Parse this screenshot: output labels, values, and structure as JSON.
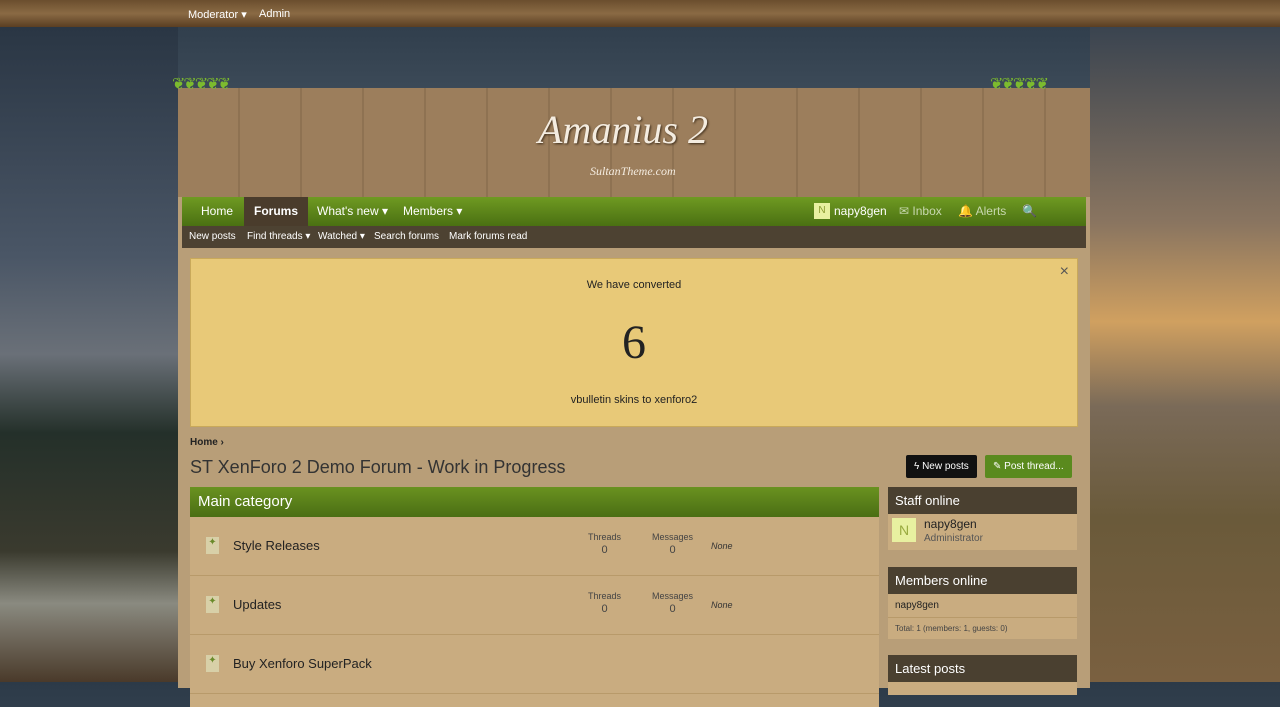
{
  "topbar": {
    "moderator": "Moderator ▾",
    "admin": "Admin"
  },
  "header": {
    "logo": "Amanius 2",
    "logo_sub": "SultanTheme.com"
  },
  "nav": {
    "home": "Home",
    "forums": "Forums",
    "whats_new": "What's new ▾",
    "members": "Members ▾",
    "avatar_letter": "N",
    "user": "napy8gen",
    "inbox": "✉ Inbox",
    "alerts": "🔔 Alerts",
    "search": "🔍 Search"
  },
  "subnav": [
    "New posts",
    "Find threads ▾",
    "Watched ▾",
    "Search forums",
    "Mark forums read"
  ],
  "notice": {
    "line1": "We have converted",
    "number": "6",
    "line2": "vbulletin skins to xenforo2",
    "close": "×"
  },
  "breadcrumb": "Home ›",
  "page_title": "ST XenForo 2 Demo Forum - Work in Progress",
  "buttons": {
    "new_posts": "ϟ New posts",
    "post_thread": "✎ Post thread..."
  },
  "category": "Main category",
  "forums": [
    {
      "name": "Style Releases",
      "threads_label": "Threads",
      "threads": "0",
      "messages_label": "Messages",
      "messages": "0",
      "last": "None"
    },
    {
      "name": "Updates",
      "threads_label": "Threads",
      "threads": "0",
      "messages_label": "Messages",
      "messages": "0",
      "last": "None"
    },
    {
      "name": "Buy Xenforo SuperPack"
    }
  ],
  "sidebar": {
    "staff_title": "Staff online",
    "staff_letter": "N",
    "staff_name": "napy8gen",
    "staff_role": "Administrator",
    "members_title": "Members online",
    "member": "napy8gen",
    "total": "Total: 1 (members: 1, guests: 0)",
    "latest_title": "Latest posts"
  }
}
